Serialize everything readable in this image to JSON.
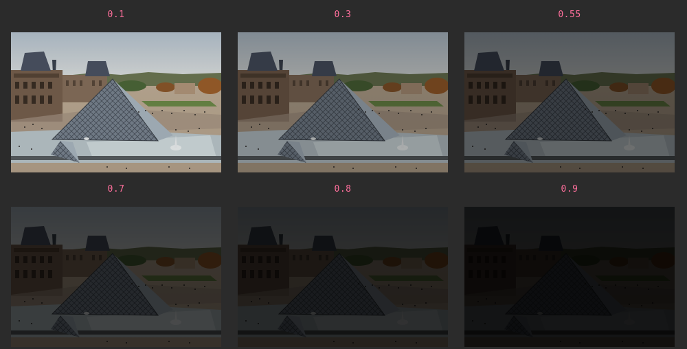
{
  "panels": [
    {
      "label": "0.1",
      "darkness": 0.1
    },
    {
      "label": "0.3",
      "darkness": 0.3
    },
    {
      "label": "0.55",
      "darkness": 0.55
    },
    {
      "label": "0.7",
      "darkness": 0.7
    },
    {
      "label": "0.8",
      "darkness": 0.8
    },
    {
      "label": "0.9",
      "darkness": 0.9
    }
  ],
  "colors": {
    "background": "#2b2b2b",
    "label": "#ff6f9c"
  }
}
